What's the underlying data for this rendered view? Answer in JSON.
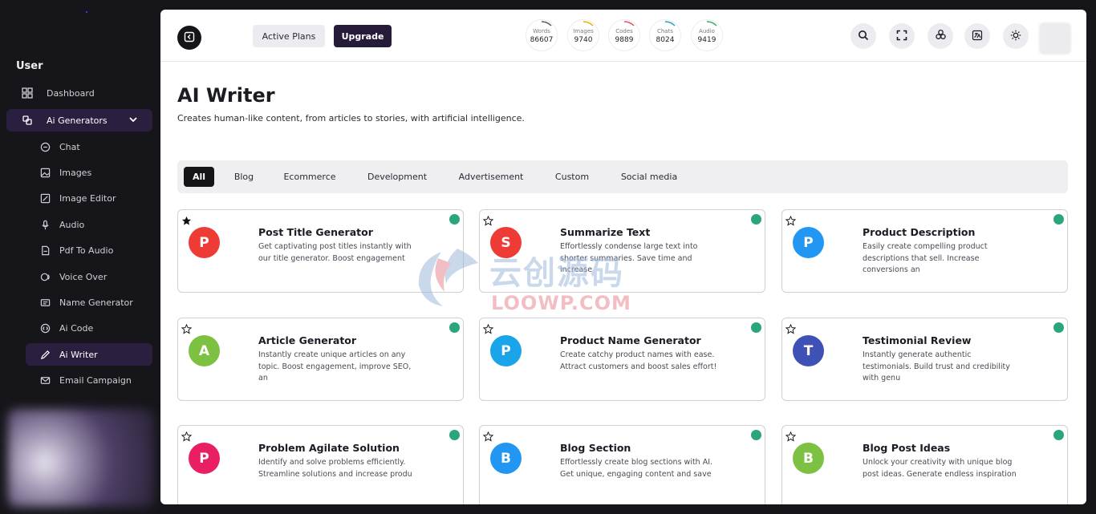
{
  "sidebar": {
    "section_label": "User",
    "items": [
      {
        "label": "Dashboard",
        "icon": "dashboard-icon"
      },
      {
        "label": "Ai Generators",
        "icon": "generators-icon",
        "expanded": true
      },
      {
        "label": "Chat",
        "icon": "chat-icon"
      },
      {
        "label": "Images",
        "icon": "image-icon"
      },
      {
        "label": "Image Editor",
        "icon": "image-editor-icon"
      },
      {
        "label": "Audio",
        "icon": "microphone-icon"
      },
      {
        "label": "Pdf To Audio",
        "icon": "pdf-icon"
      },
      {
        "label": "Voice Over",
        "icon": "voice-icon"
      },
      {
        "label": "Name Generator",
        "icon": "name-icon"
      },
      {
        "label": "Ai Code",
        "icon": "code-icon"
      },
      {
        "label": "Ai Writer",
        "icon": "writer-icon",
        "active": true
      },
      {
        "label": "Email Campaign",
        "icon": "email-icon"
      }
    ]
  },
  "header": {
    "active_plans_label": "Active Plans",
    "upgrade_label": "Upgrade",
    "stats": [
      {
        "label": "Words",
        "value": "86607",
        "color": "#555555"
      },
      {
        "label": "Images",
        "value": "9740",
        "color": "#e0b100"
      },
      {
        "label": "Codes",
        "value": "9889",
        "color": "#e04a5a"
      },
      {
        "label": "Chats",
        "value": "8024",
        "color": "#18a0b8"
      },
      {
        "label": "Audio",
        "value": "9419",
        "color": "#3aa86a"
      }
    ]
  },
  "page": {
    "title": "AI Writer",
    "subtitle": "Creates human-like content, from articles to stories, with artificial intelligence."
  },
  "filters": [
    "All",
    "Blog",
    "Ecommerce",
    "Development",
    "Advertisement",
    "Custom",
    "Social media"
  ],
  "cards": [
    {
      "letter": "P",
      "color": "#ef3b36",
      "title": "Post Title Generator",
      "desc": "Get captivating post titles instantly with our title generator. Boost engagement",
      "favorite": true
    },
    {
      "letter": "S",
      "color": "#ef3b36",
      "title": "Summarize Text",
      "desc": "Effortlessly condense large text into shorter summaries. Save time and increase",
      "favorite": false
    },
    {
      "letter": "P",
      "color": "#2196f3",
      "title": "Product Description",
      "desc": "Easily create compelling product descriptions that sell. Increase conversions an",
      "favorite": false
    },
    {
      "letter": "A",
      "color": "#7cc142",
      "title": "Article Generator",
      "desc": "Instantly create unique articles on any topic. Boost engagement, improve SEO, an",
      "favorite": false
    },
    {
      "letter": "P",
      "color": "#1aa5ea",
      "title": "Product Name Generator",
      "desc": "Create catchy product names with ease. Attract customers and boost sales effort!",
      "favorite": false
    },
    {
      "letter": "T",
      "color": "#3f51b5",
      "title": "Testimonial Review",
      "desc": "Instantly generate authentic testimonials. Build trust and credibility with genu",
      "favorite": false
    },
    {
      "letter": "P",
      "color": "#e91e63",
      "title": "Problem Agilate Solution",
      "desc": "Identify and solve problems efficiently. Streamline solutions and increase produ",
      "favorite": false
    },
    {
      "letter": "B",
      "color": "#2196f3",
      "title": "Blog Section",
      "desc": "Effortlessly create blog sections with AI. Get unique, engaging content and save",
      "favorite": false
    },
    {
      "letter": "B",
      "color": "#7cc142",
      "title": "Blog Post Ideas",
      "desc": "Unlock your creativity with unique blog post ideas. Generate endless inspiration",
      "favorite": false
    }
  ],
  "watermark": {
    "cn": "云创源码",
    "en": "LOOWP.COM"
  }
}
